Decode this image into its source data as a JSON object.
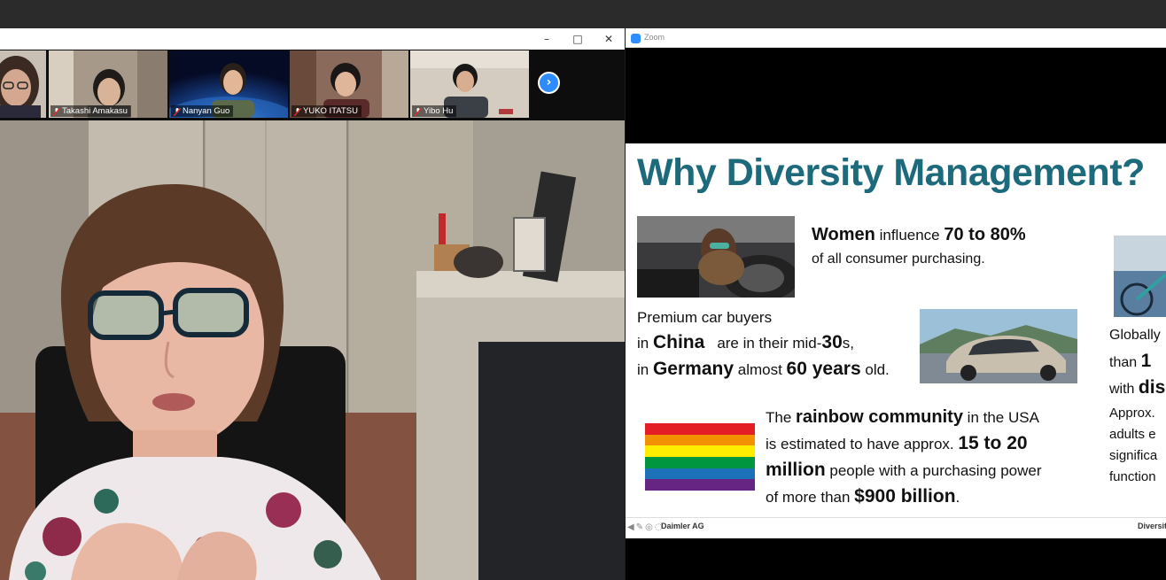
{
  "left_window": {
    "controls": {
      "minimize": "–",
      "maximize": "□",
      "close": "✕"
    },
    "participants": [
      {
        "name": ""
      },
      {
        "name": "Takashi Amakasu"
      },
      {
        "name": "Nanyan Guo"
      },
      {
        "name": "YUKO ITATSU"
      },
      {
        "name": "Yibo Hu"
      }
    ],
    "next_icon": "›"
  },
  "right_window": {
    "title": "Zoom"
  },
  "slide": {
    "title": "Why Diversity Management?",
    "women": {
      "w1": "Women",
      "w2": " influence ",
      "w3": "70 to 80%",
      "line2": "of all consumer purchasing."
    },
    "car": {
      "line1": "Premium car buyers",
      "in1": "in ",
      "china": "China",
      "mid": "are in their mid-",
      "thirty": "30",
      "s": "s,",
      "in2": "in ",
      "germany": "Germany",
      "almost": " almost ",
      "sixty": "60 years",
      "old": " old."
    },
    "rainbow": {
      "r1": "The ",
      "r2": "rainbow community",
      "r3": " in the USA",
      "r4": "is estimated to have approx. ",
      "r5": "15 to 20",
      "r6": "million",
      "r7": " people with a purchasing power",
      "r8": "of more than ",
      "r9": "$900 billion",
      "r10": "."
    },
    "global": {
      "g1": "Globally",
      "g2a": "than ",
      "g2b": "1 ",
      "g3a": "with ",
      "g3b": "dis",
      "g4": "Approx.",
      "g5": "adults e",
      "g6": "significa",
      "g7": "function"
    },
    "footer": {
      "left": "Daimler AG",
      "right": "Diversit"
    },
    "rainbow_colors": [
      "#e31e24",
      "#f39200",
      "#ffed00",
      "#009640",
      "#1d71b8",
      "#662483"
    ]
  }
}
